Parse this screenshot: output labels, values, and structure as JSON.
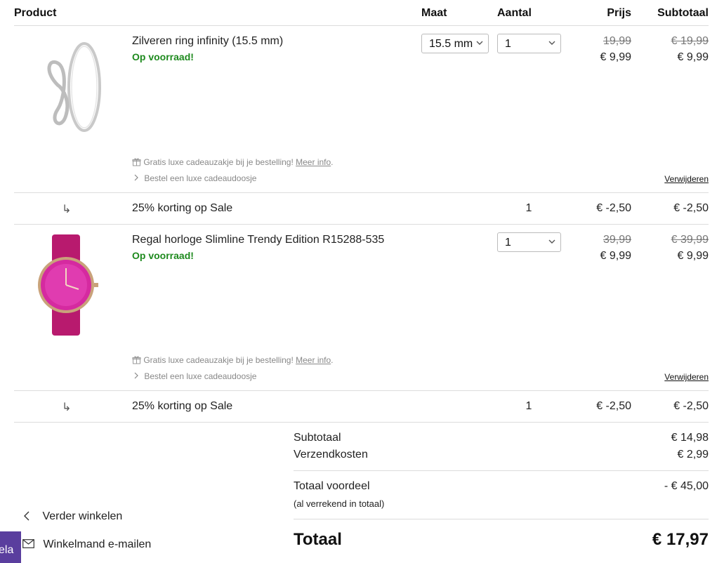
{
  "header": {
    "product": "Product",
    "maat": "Maat",
    "aantal": "Aantal",
    "prijs": "Prijs",
    "subtotaal": "Subtotaal"
  },
  "items": [
    {
      "name": "Zilveren ring infinity (15.5 mm)",
      "stock": "Op voorraad!",
      "size": "15.5 mm",
      "qty": "1",
      "old_price": "19,99",
      "price": "€ 9,99",
      "old_subtotal": "€ 19,99",
      "subtotal": "€ 9,99",
      "gift_text": "Gratis luxe cadeauzakje bij je bestelling!",
      "gift_link": "Meer info",
      "gift_dot": ".",
      "box_text": "Bestel een luxe cadeaudoosje",
      "remove": "Verwijderen"
    },
    {
      "name": "Regal horloge Slimline Trendy Edition R15288-535",
      "stock": "Op voorraad!",
      "qty": "1",
      "old_price": "39,99",
      "price": "€ 9,99",
      "old_subtotal": "€ 39,99",
      "subtotal": "€ 9,99",
      "gift_text": "Gratis luxe cadeauzakje bij je bestelling!",
      "gift_link": "Meer info",
      "gift_dot": ".",
      "box_text": "Bestel een luxe cadeaudoosje",
      "remove": "Verwijderen"
    }
  ],
  "discounts": [
    {
      "arrow": "↳",
      "label": "25% korting op Sale",
      "qty": "1",
      "price": "€ -2,50",
      "subtotal": "€ -2,50"
    },
    {
      "arrow": "↳",
      "label": "25% korting op Sale",
      "qty": "1",
      "price": "€ -2,50",
      "subtotal": "€ -2,50"
    }
  ],
  "summary": {
    "subtotal_label": "Subtotaal",
    "subtotal_value": "€ 14,98",
    "shipping_label": "Verzendkosten",
    "shipping_value": "€ 2,99",
    "advantage_label": "Totaal voordeel",
    "advantage_value": "- € 45,00",
    "advantage_note": "(al verrekend in totaal)",
    "total_label": "Totaal",
    "total_value": "€ 17,97"
  },
  "links": {
    "continue": "Verder winkelen",
    "email": "Winkelmand e-mailen"
  },
  "side_tab": "ela",
  "icons": {
    "gift": "gift-icon",
    "chevron_right": "chevron-right-icon",
    "chevron_down": "chevron-down-icon",
    "chevron_left": "chevron-left-icon",
    "mail": "mail-icon"
  },
  "colors": {
    "stock_green": "#1e8a1e",
    "side_tab_purple": "#5a3e9e",
    "watch_pink": "#c0207a"
  }
}
